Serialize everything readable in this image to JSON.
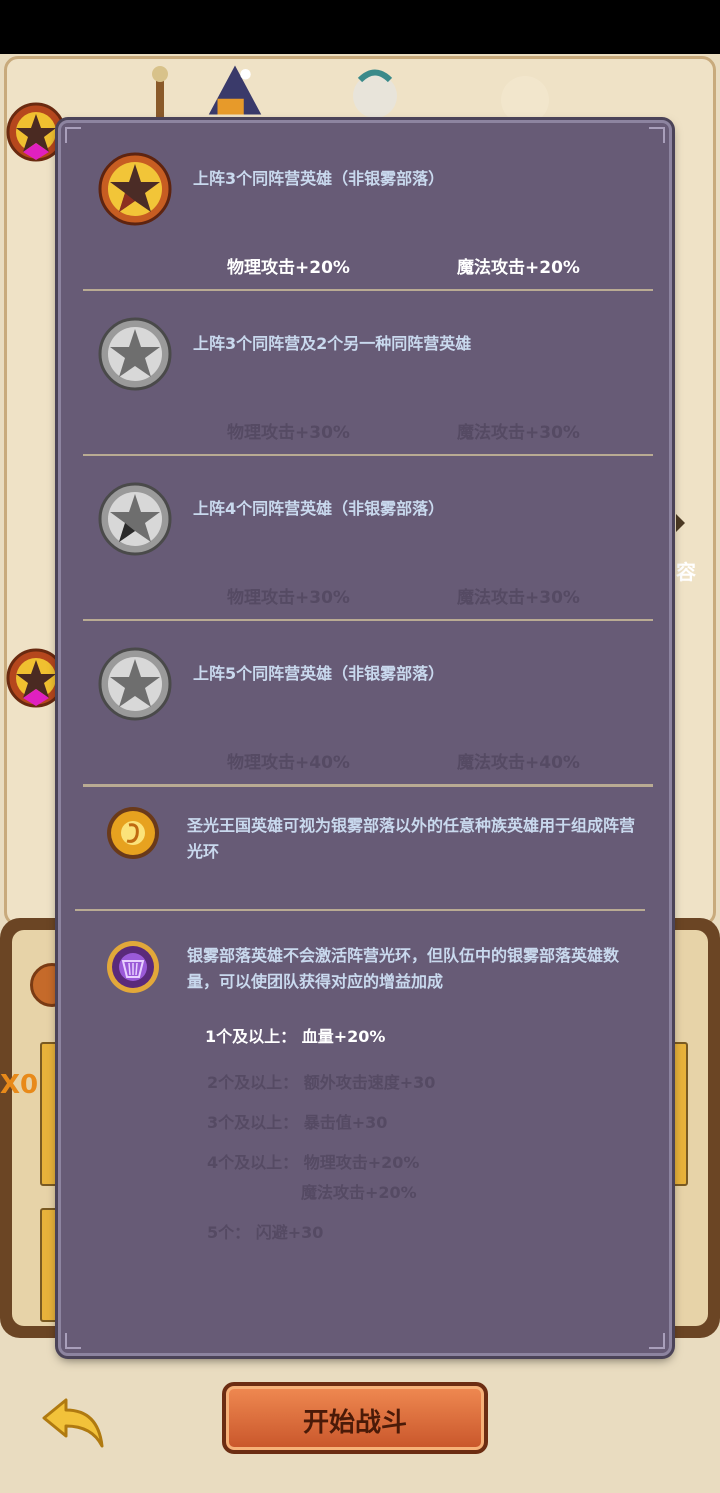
{
  "panel": {
    "sections": [
      {
        "condition": "上阵3个同阵营英雄（非银雾部落）",
        "bonus_1": "物理攻击+20%",
        "bonus_2": "魔法攻击+20%",
        "active": true,
        "icon": "gold-star-emblem-icon"
      },
      {
        "condition": "上阵3个同阵营及2个另一种同阵营英雄",
        "bonus_1": "物理攻击+30%",
        "bonus_2": "魔法攻击+30%",
        "active": false,
        "icon": "silver-star-emblem-icon"
      },
      {
        "condition": "上阵4个同阵营英雄（非银雾部落）",
        "bonus_1": "物理攻击+30%",
        "bonus_2": "魔法攻击+30%",
        "active": false,
        "icon": "silver-star-emblem-icon"
      },
      {
        "condition": "上阵5个同阵营英雄（非银雾部落）",
        "bonus_1": "物理攻击+40%",
        "bonus_2": "魔法攻击+40%",
        "active": false,
        "icon": "silver-star-emblem-icon"
      }
    ],
    "holy_note": "圣光王国英雄可视为银雾部落以外的任意种族英雄用于组成阵营光环",
    "silver_note": "银雾部落英雄不会激活阵营光环，但队伍中的银雾部落英雄数量，可以使团队获得对应的增益加成",
    "tiers": {
      "t1": "1个及以上：  血量+20%",
      "t2": "2个及以上：  额外攻击速度+30",
      "t3": "3个及以上：  暴击值+30",
      "t4": "4个及以上：  物理攻击+20%",
      "t4b": "魔法攻击+20%",
      "t5": "5个：  闪避+30"
    }
  },
  "background": {
    "side_text": "容",
    "start_button": "开始战斗"
  },
  "colors": {
    "panel": "#675b76",
    "active_text": "#ffffff",
    "inactive_text": "#554a63",
    "condition_text": "#c9d9ee",
    "button": "#d9693a"
  }
}
